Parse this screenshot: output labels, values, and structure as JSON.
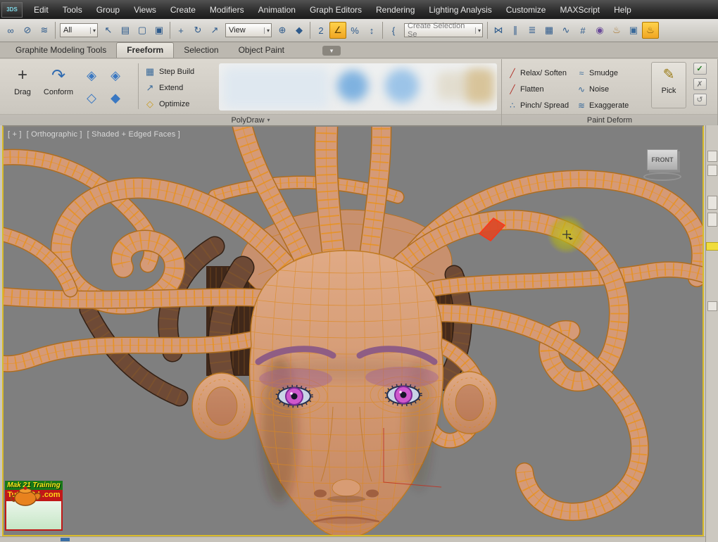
{
  "menu": {
    "logo": "3DS",
    "items": [
      "Edit",
      "Tools",
      "Group",
      "Views",
      "Create",
      "Modifiers",
      "Animation",
      "Graph Editors",
      "Rendering",
      "Lighting Analysis",
      "Customize",
      "MAXScript",
      "Help"
    ]
  },
  "toolbar": {
    "dropdown_arrow": "▾",
    "items": [
      {
        "t": "icon",
        "name": "select-and-link-icon",
        "g": "∞"
      },
      {
        "t": "icon",
        "name": "unlink-selection-icon",
        "g": "⊘"
      },
      {
        "t": "icon",
        "name": "bind-to-spacewarp-icon",
        "g": "≋"
      },
      {
        "t": "sep"
      },
      {
        "t": "dd",
        "name": "selection-filter-dropdown",
        "v": "All",
        "w": 54
      },
      {
        "t": "icon",
        "name": "select-object-icon",
        "g": "↖"
      },
      {
        "t": "icon",
        "name": "select-by-name-icon",
        "g": "▤"
      },
      {
        "t": "icon",
        "name": "selection-region-icon",
        "g": "▢"
      },
      {
        "t": "icon",
        "name": "window-crossing-icon",
        "g": "▣"
      },
      {
        "t": "sep"
      },
      {
        "t": "icon",
        "name": "select-and-move-icon",
        "g": "+"
      },
      {
        "t": "icon",
        "name": "select-and-rotate-icon",
        "g": "↻"
      },
      {
        "t": "icon",
        "name": "select-and-scale-icon",
        "g": "↗"
      },
      {
        "t": "dd",
        "name": "reference-coordinate-dropdown",
        "v": "View",
        "w": 66
      },
      {
        "t": "icon",
        "name": "use-pivot-center-icon",
        "g": "⊕"
      },
      {
        "t": "icon",
        "name": "select-and-manipulate-icon",
        "g": "◆"
      },
      {
        "t": "sep"
      },
      {
        "t": "icon",
        "name": "snap-toggle-2d-icon",
        "g": "2"
      },
      {
        "t": "icon",
        "name": "angle-snap-icon",
        "g": "∠",
        "active": true
      },
      {
        "t": "icon",
        "name": "percent-snap-icon",
        "g": "%"
      },
      {
        "t": "icon",
        "name": "spinner-snap-icon",
        "g": "↕"
      },
      {
        "t": "sep"
      },
      {
        "t": "icon",
        "name": "edit-named-selections-icon",
        "g": "{"
      },
      {
        "t": "dd",
        "name": "named-selection-set-dropdown",
        "v": "Create Selection Se",
        "w": 112,
        "muted": true
      },
      {
        "t": "sep"
      },
      {
        "t": "icon",
        "name": "mirror-icon",
        "g": "⋈"
      },
      {
        "t": "icon",
        "name": "align-icon",
        "g": "∥"
      },
      {
        "t": "icon",
        "name": "layer-manager-icon",
        "g": "≣"
      },
      {
        "t": "icon",
        "name": "graphite-ribbon-toggle-icon",
        "g": "▦"
      },
      {
        "t": "icon",
        "name": "curve-editor-icon",
        "g": "∿"
      },
      {
        "t": "icon",
        "name": "schematic-view-icon",
        "g": "#"
      },
      {
        "t": "icon",
        "name": "material-editor-icon",
        "g": "◉",
        "c": "#6a4a9a"
      },
      {
        "t": "icon",
        "name": "render-setup-icon",
        "g": "♨",
        "c": "#a8742a"
      },
      {
        "t": "icon",
        "name": "rendered-frame-window-icon",
        "g": "▣",
        "c": "#3a6a9a"
      },
      {
        "t": "icon",
        "name": "render-production-icon",
        "g": "♨",
        "c": "#7a5208",
        "active": true
      }
    ]
  },
  "ribbon": {
    "config_icon": "▾",
    "tabs": [
      {
        "label": "Graphite Modeling Tools",
        "active": false
      },
      {
        "label": "Freeform",
        "active": true
      },
      {
        "label": "Selection",
        "active": false
      },
      {
        "label": "Object Paint",
        "active": false
      }
    ],
    "polydraw": {
      "label": "PolyDraw",
      "arrow_icon": "▾",
      "drag_label": "Drag",
      "drag_icon": "+",
      "conform_label": "Conform",
      "conform_icon": "↷",
      "conform_variant_icons": [
        "◈",
        "◈",
        "◇",
        "◆"
      ],
      "buttons": [
        {
          "label": "Step Build",
          "icon": "▦",
          "color": "#3a6a9a"
        },
        {
          "label": "Extend",
          "icon": "↗",
          "color": "#3a6a9a"
        },
        {
          "label": "Optimize",
          "icon": "◇",
          "color": "#c89a20"
        }
      ]
    },
    "paint_deform": {
      "label": "Paint Deform",
      "pick_label": "Pick",
      "pick_icon": "✎",
      "confirm_icon": "✓",
      "cancel_icon": "✗",
      "reset_icon": "↺",
      "buttons": [
        {
          "label": "Relax/ Soften",
          "icon": "╱",
          "color": "#b03028"
        },
        {
          "label": "Smudge",
          "icon": "≈",
          "color": "#3a6a9a"
        },
        {
          "label": "Flatten",
          "icon": "╱",
          "color": "#b03028"
        },
        {
          "label": "Noise",
          "icon": "∿",
          "color": "#3a6a9a"
        },
        {
          "label": "Pinch/ Spread",
          "icon": "∴",
          "color": "#3a6a9a"
        },
        {
          "label": "Exaggerate",
          "icon": "≋",
          "color": "#3a6a9a"
        }
      ]
    }
  },
  "viewport": {
    "label_plus": "[ + ]",
    "label_view": "[ Orthographic ]",
    "label_shading": "[ Shaded + Edged Faces ]",
    "viewcube_label": "FRONT",
    "watermark_line1": "Mak 21 Training",
    "watermark_line2": "Tutors3d .com"
  },
  "colors": {
    "wireframe_orange": "#e8921e",
    "skin": "#d59a77",
    "viewport_gray": "#7f7f7f",
    "selection_red": "#dc4a28",
    "brush_yellow": "#b9b91c",
    "active_highlight": "#f0a623"
  }
}
